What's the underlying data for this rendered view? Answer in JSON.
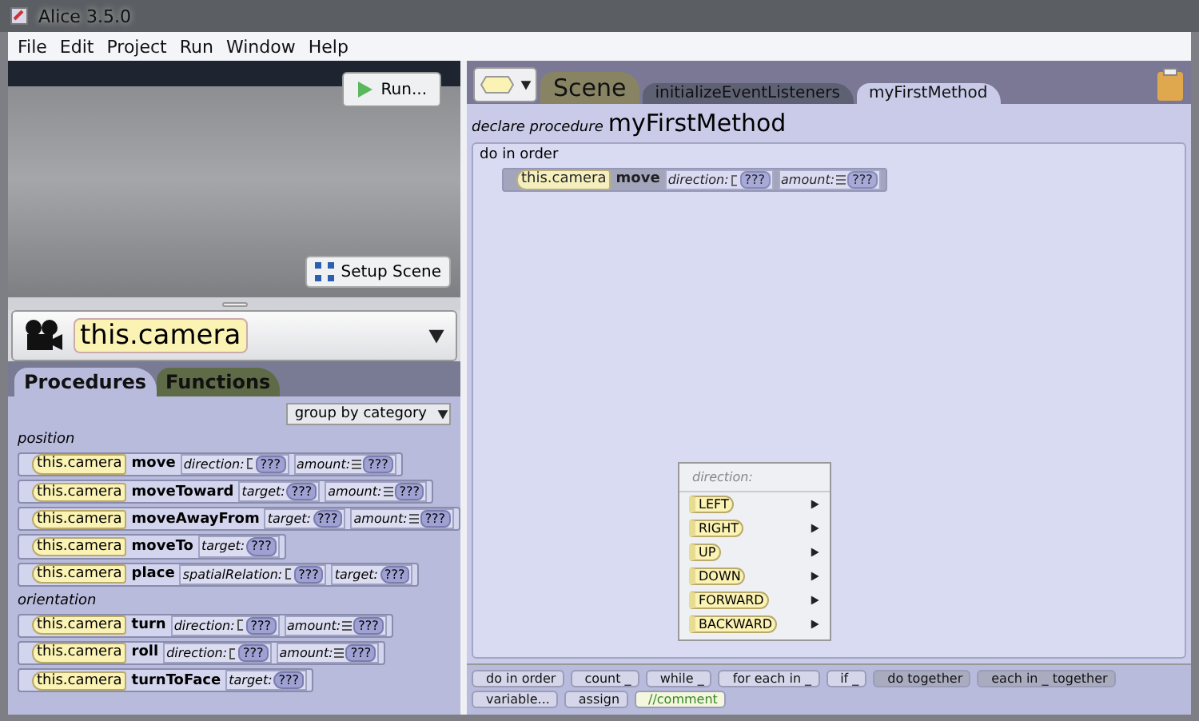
{
  "window": {
    "title": "Alice 3.5.0"
  },
  "menu": [
    "File",
    "Edit",
    "Project",
    "Run",
    "Window",
    "Help"
  ],
  "scene_view": {
    "run_button": "Run...",
    "setup_button": "Setup Scene"
  },
  "selector": {
    "value": "this.camera"
  },
  "palette_tabs": [
    {
      "label": "Procedures",
      "selected": true
    },
    {
      "label": "Functions",
      "selected": false
    }
  ],
  "group_dropdown": "group by category",
  "categories": [
    {
      "name": "position",
      "procedures": [
        {
          "target": "this.camera",
          "name": "move",
          "params": [
            {
              "label": "direction:",
              "kind": "enum",
              "value": "???"
            },
            {
              "label": "amount:",
              "kind": "number",
              "value": "???"
            }
          ]
        },
        {
          "target": "this.camera",
          "name": "moveToward",
          "params": [
            {
              "label": "target:",
              "kind": "object",
              "value": "???"
            },
            {
              "label": "amount:",
              "kind": "number",
              "value": "???"
            }
          ]
        },
        {
          "target": "this.camera",
          "name": "moveAwayFrom",
          "params": [
            {
              "label": "target:",
              "kind": "object",
              "value": "???"
            },
            {
              "label": "amount:",
              "kind": "number",
              "value": "???"
            }
          ]
        },
        {
          "target": "this.camera",
          "name": "moveTo",
          "params": [
            {
              "label": "target:",
              "kind": "object",
              "value": "???"
            }
          ]
        },
        {
          "target": "this.camera",
          "name": "place",
          "params": [
            {
              "label": "spatialRelation:",
              "kind": "enum",
              "value": "???"
            },
            {
              "label": "target:",
              "kind": "object",
              "value": "???"
            }
          ]
        }
      ]
    },
    {
      "name": "orientation",
      "procedures": [
        {
          "target": "this.camera",
          "name": "turn",
          "params": [
            {
              "label": "direction:",
              "kind": "enum",
              "value": "???"
            },
            {
              "label": "amount:",
              "kind": "number",
              "value": "???"
            }
          ]
        },
        {
          "target": "this.camera",
          "name": "roll",
          "params": [
            {
              "label": "direction:",
              "kind": "enum",
              "value": "???"
            },
            {
              "label": "amount:",
              "kind": "number",
              "value": "???"
            }
          ]
        },
        {
          "target": "this.camera",
          "name": "turnToFace",
          "params": [
            {
              "label": "target:",
              "kind": "object",
              "value": "???"
            }
          ]
        }
      ]
    }
  ],
  "editor_tabs": [
    {
      "label": "Scene",
      "kind": "class",
      "selected": false
    },
    {
      "label": "initializeEventListeners",
      "kind": "method",
      "selected": false
    },
    {
      "label": "myFirstMethod",
      "kind": "method",
      "selected": true
    }
  ],
  "declaration": {
    "prefix": "declare procedure",
    "name": "myFirstMethod"
  },
  "body": {
    "label": "do in order",
    "statements": [
      {
        "target": "this.camera",
        "name": "move",
        "params": [
          {
            "label": "direction:",
            "kind": "enum",
            "value": "???"
          },
          {
            "label": "amount:",
            "kind": "number",
            "value": "???"
          }
        ]
      }
    ]
  },
  "popup": {
    "title": "direction:",
    "items": [
      "LEFT",
      "RIGHT",
      "UP",
      "DOWN",
      "FORWARD",
      "BACKWARD"
    ]
  },
  "control_palette": [
    {
      "label": "do in order",
      "kind": "plain"
    },
    {
      "label": "count _",
      "kind": "plain"
    },
    {
      "label": "while _",
      "kind": "plain"
    },
    {
      "label": "for each in _",
      "kind": "plain"
    },
    {
      "label": "if _",
      "kind": "plain"
    },
    {
      "label": "do together",
      "kind": "parallel"
    },
    {
      "label": "each in _ together",
      "kind": "parallel"
    },
    {
      "label": "variable...",
      "kind": "plain"
    },
    {
      "label": "assign",
      "kind": "plain"
    },
    {
      "label": "//comment",
      "kind": "comment"
    }
  ]
}
